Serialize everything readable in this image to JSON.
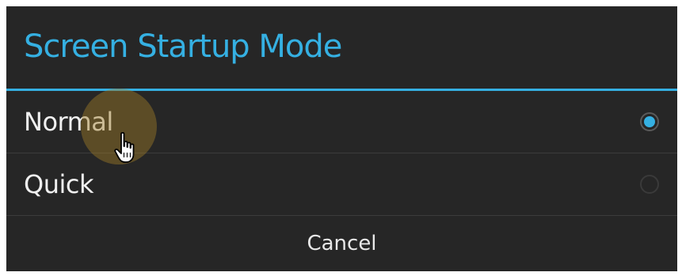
{
  "dialog": {
    "title": "Screen Startup Mode",
    "options": [
      {
        "label": "Normal",
        "selected": true
      },
      {
        "label": "Quick",
        "selected": false
      }
    ],
    "cancel_label": "Cancel"
  },
  "colors": {
    "accent": "#35b0e2",
    "background": "#262626",
    "text": "#f0f0f0",
    "divider": "#3c3c3c"
  },
  "icons": {
    "cursor": "hand-pointer-icon",
    "selected_radio": "radio-checked-icon",
    "unselected_radio": "radio-unchecked-icon"
  }
}
